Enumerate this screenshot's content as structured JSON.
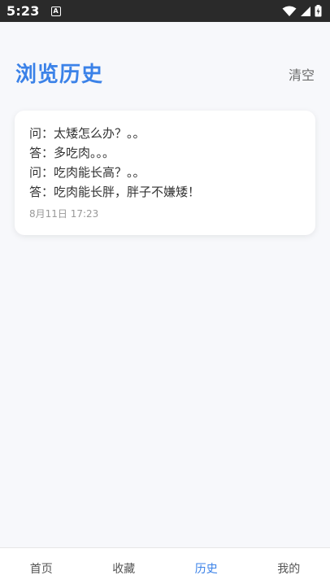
{
  "status_bar": {
    "time": "5:23",
    "notification_icon_letter": "A",
    "icons": [
      "wifi-icon",
      "signal-icon",
      "battery-icon"
    ]
  },
  "header": {
    "title": "浏览历史",
    "clear_label": "清空"
  },
  "history": {
    "items": [
      {
        "lines": [
          "问：太矮怎么办？。。",
          "答：多吃肉。。。",
          "问：吃肉能长高？。。",
          "答：吃肉能长胖，胖子不嫌矮！"
        ],
        "time": "8月11日 17:23"
      }
    ]
  },
  "bottom_nav": {
    "items": [
      {
        "label": "首页"
      },
      {
        "label": "收藏"
      },
      {
        "label": "历史"
      },
      {
        "label": "我的"
      }
    ],
    "active_index": 2
  },
  "colors": {
    "accent": "#3b82e8",
    "background": "#f7f8fb",
    "status_bar": "#2a2a2a"
  }
}
